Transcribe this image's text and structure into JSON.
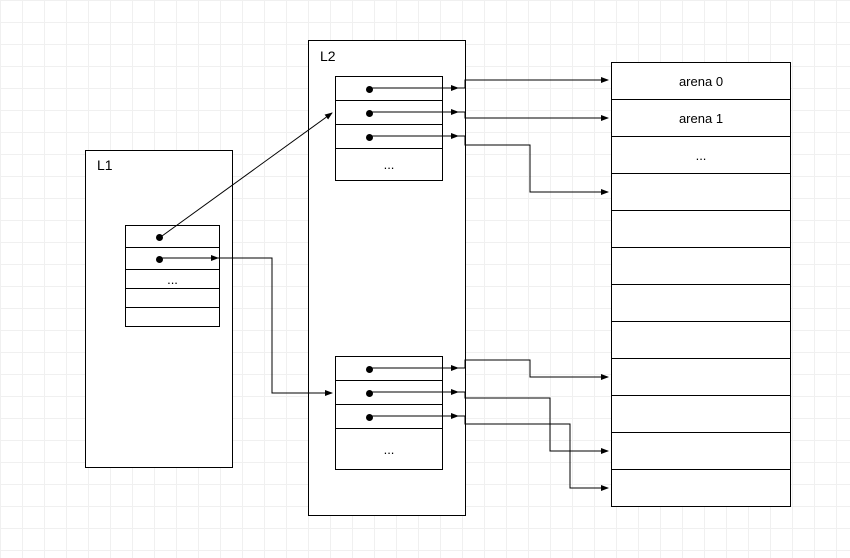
{
  "l1": {
    "title": "L1",
    "rows": [
      "",
      "",
      "...",
      "",
      ""
    ]
  },
  "l2": {
    "title": "L2",
    "box_top": {
      "rows": [
        "",
        "",
        "",
        "..."
      ]
    },
    "box_bottom": {
      "rows": [
        "",
        "",
        "",
        "..."
      ]
    }
  },
  "arena": {
    "rows": [
      "arena 0",
      "arena 1",
      "...",
      "",
      "",
      "",
      "",
      "",
      "",
      "",
      "",
      ""
    ]
  }
}
